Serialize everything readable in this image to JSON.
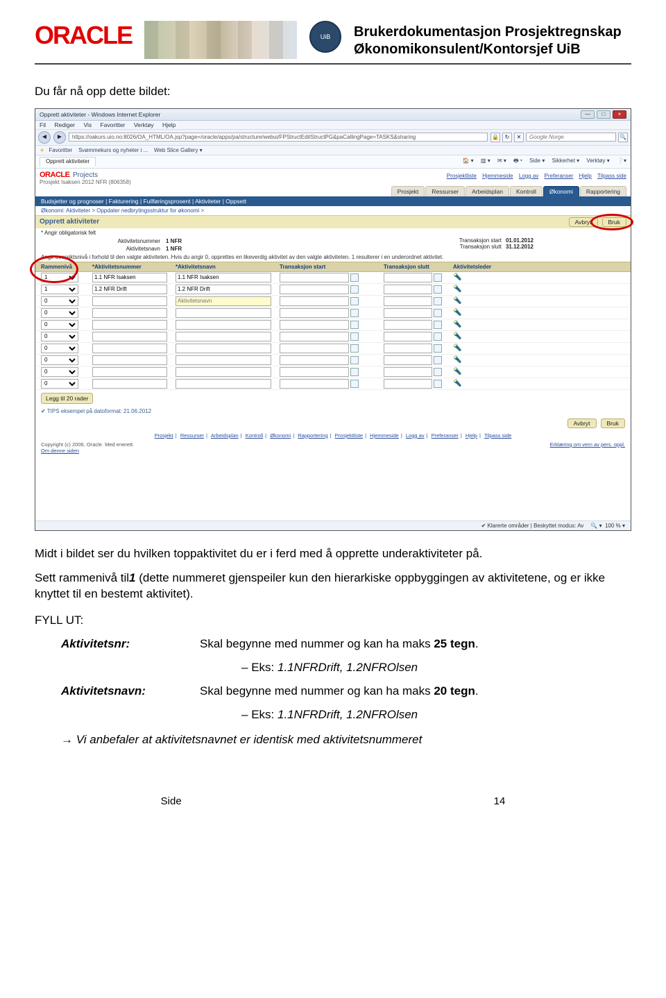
{
  "header": {
    "logo_text": "ORACLE",
    "seal_text": "UiB",
    "title_line1": "Brukerdokumentasjon Prosjektregnskap",
    "title_line2": "Økonomikonsulent/Kontorsjef UiB"
  },
  "intro": "Du får nå opp dette bildet:",
  "ss": {
    "win_title": "Opprett aktiviteter - Windows Internet Explorer",
    "menu": {
      "fil": "Fil",
      "rediger": "Rediger",
      "vis": "Vis",
      "fav": "Favoritter",
      "verktoy": "Verktøy",
      "hjelp": "Hjelp"
    },
    "url": "https://oakurs.uio.no:8026/OA_HTML/OA.jsp?page=/oracle/apps/pa/structure/webui/FPStructEditStructPG&paCallingPage=TASKS&sharing",
    "search_placeholder": "Google Norge",
    "fav_label": "Favoritter",
    "fav_item1": "Svømmekurs og nyheter i ...",
    "fav_item2": "Web Slice Gallery",
    "tab_name": "Opprett aktiviteter",
    "ie_tools": {
      "side": "Side",
      "sikkerhet": "Sikkerhet",
      "verktoy": "Verktøy"
    },
    "oracle_small": "ORACLE",
    "projects": "Projects",
    "top_links": [
      "Prosjektliste",
      "Hjemmeside",
      "Logg av",
      "Preferanser",
      "Hjelp",
      "Tilpass side"
    ],
    "project_line": "Prosjekt Isaksen 2012 NFR (806358)",
    "tabs": [
      "Prosjekt",
      "Ressurser",
      "Arbeidsplan",
      "Kontroll",
      "Økonomi",
      "Rapportering"
    ],
    "subnav": "Budsjetter og prognoser  |  Fakturering  |  Fullføringsprosent  |  Aktiviteter  |  Oppsett",
    "bc": "Økonomi: Aktiviteter  >  Oppdater nedbrytingsstruktur for økonomi  >",
    "panel_title": "Opprett aktiviteter",
    "hint": "* Angir obligatorisk felt",
    "btn_cancel": "Avbryt",
    "btn_apply": "Bruk",
    "f_num_lab": "Aktivitetsnummer",
    "f_num_val": "1 NFR",
    "f_navn_lab": "Aktivitetsnavn",
    "f_navn_val": "1 NFR",
    "f_tstart_lab": "Transaksjon start",
    "f_tstart_val": "01.01.2012",
    "f_tslutt_lab": "Transaksjon slutt",
    "f_tslutt_val": "31.12.2012",
    "note": "Angir oversiktsnivå i forhold til den valgte aktiviteten. Hvis du angir 0, opprettes en likeverdig aktivitet av den valgte aktiviteten. 1 resulterer i en underordnet aktivitet.",
    "gh": {
      "g1": "Rammenivå",
      "g2": "*Aktivitetsnummer",
      "g3": "*Aktivitetsnavn",
      "g4": "Transaksjon start",
      "g5": "Transaksjon slutt",
      "g6": "Aktivitetsleder"
    },
    "rows": [
      {
        "lvl": "1",
        "num": "1.1 NFR Isaksen",
        "navn": "1.1 NFR Isaksen"
      },
      {
        "lvl": "1",
        "num": "1.2 NFR Drift",
        "navn": "1.2 NFR Drift"
      }
    ],
    "placeholder_navn": "Aktivitetsnavn",
    "empty_lvl": "0",
    "add_rows": "Legg til 20 rader",
    "tips": "TIPS eksempel på datoformat: 21.06.2012",
    "foot_links": [
      "Prosjekt",
      "Ressurser",
      "Arbeidsplan",
      "Kontroll",
      "Økonomi",
      "Rapportering",
      "Prosjektliste",
      "Hjemmeside",
      "Logg av",
      "Preferanser",
      "Hjelp",
      "Tilpass side"
    ],
    "copyright": "Copyright (c) 2006, Oracle. Med enerett.",
    "about": "Om denne siden",
    "privacy": "Erklæring om vern av pers. oppl.",
    "status_trusted": "Klarerte områder | Beskyttet modus: Av",
    "status_zoom": "100 %"
  },
  "p1": "Midt i bildet ser du hvilken toppaktivitet du er i ferd med å opprette underaktiviteter på.",
  "p2a": "Sett rammenivå til",
  "p2b": "1",
  "p2c": " (dette nummeret gjenspeiler kun den hierarkiske oppbyggingen av aktivitetene, og er ikke knyttet til en bestemt aktivitet).",
  "fyll": "FYLL UT:",
  "def1_term": "Aktivitetsnr:",
  "def1_desc": "Skal begynne med nummer og kan ha maks 25 tegn.",
  "def1_ex": "Eks: 1.1NFRDrift, 1.2NFROlsen",
  "def2_term": "Aktivitetsnavn:",
  "def2_desc": "Skal begynne med nummer og kan ha maks 20 tegn.",
  "def2_ex": "Eks: 1.1NFRDrift, 1.2NFROlsen",
  "arrow": "→ Vi anbefaler at aktivitetsnavnet er identisk med aktivitetsnummeret",
  "footer_side": "Side",
  "footer_num": "14"
}
